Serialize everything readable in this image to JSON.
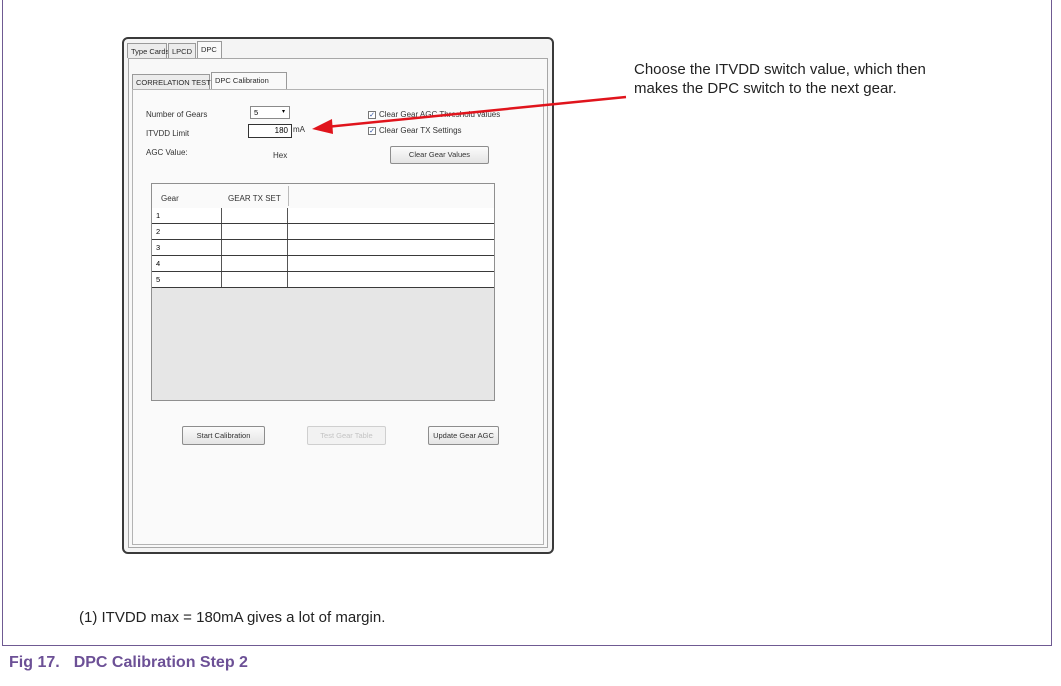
{
  "outer_tabs": [
    "Type Cards",
    "LPCD",
    "DPC"
  ],
  "inner_tabs": [
    "CORRELATION TEST",
    "DPC Calibration"
  ],
  "form": {
    "gears_label": "Number of Gears",
    "gears_value": "5",
    "itvdd_label": "ITVDD Limit",
    "itvdd_value": "180",
    "itvdd_unit": "mA",
    "agc_label": "AGC Value:",
    "agc_unit": "Hex",
    "chk1_label": "Clear Gear AGC Threshold values",
    "chk2_label": "Clear Gear TX Settings",
    "clear_button": "Clear Gear Values"
  },
  "table": {
    "headers": [
      "Gear",
      "GEAR TX SET"
    ],
    "rows": [
      "1",
      "2",
      "3",
      "4",
      "5"
    ]
  },
  "buttons": {
    "start": "Start Calibration",
    "disabled": "Test Gear Table",
    "update": "Update Gear AGC"
  },
  "annotation": "Choose the ITVDD switch value, which then makes the DPC switch to the next gear.",
  "note": "(1)  ITVDD max = 180mA gives a lot of margin.",
  "caption": {
    "number": "Fig 17.",
    "title": "DPC Calibration Step 2"
  },
  "colors": {
    "arrow": "#e0141c",
    "caption": "#6c5096",
    "frame": "#6f5a92"
  }
}
